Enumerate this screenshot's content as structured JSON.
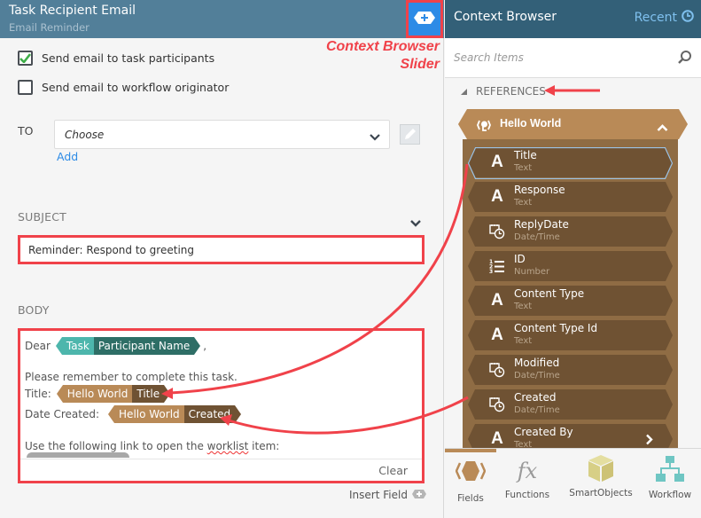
{
  "left_panel": {
    "title": "Task Recipient Email",
    "subtitle": "Email Reminder",
    "slider_button_icon": "context-browser-toggle-icon",
    "annotation_slider": [
      "Context Browser",
      "Slider"
    ],
    "options": [
      {
        "label": "Send email to task participants",
        "checked": true
      },
      {
        "label": "Send email to workflow originator",
        "checked": false
      }
    ],
    "to": {
      "label": "TO",
      "select_value": "Choose",
      "add_link": "Add"
    },
    "subject": {
      "label": "SUBJECT",
      "value": "Reminder: Respond to greeting"
    },
    "body": {
      "label": "BODY",
      "greeting_prefix": "Dear",
      "greeting_chip": {
        "source": "Task",
        "field": "Participant Name"
      },
      "greeting_suffix": ",",
      "line_remember": "Please remember to complete this task.",
      "title_label": "Title:",
      "title_chip": {
        "source": "Hello World",
        "field": "Title"
      },
      "created_label": "Date Created:",
      "created_chip": {
        "source": "Hello World",
        "field": "Created"
      },
      "link_line_pre": "Use the following link to open the ",
      "link_line_misspelled": "worklist",
      "link_line_post": " item:",
      "clear_button": "Clear"
    },
    "insert_field": "Insert Field"
  },
  "context_browser": {
    "title": "Context Browser",
    "recent_label": "Recent",
    "search_placeholder": "Search Items",
    "references_label": "REFERENCES",
    "reference": {
      "name": "Hello World",
      "fields": [
        {
          "name": "Title",
          "type": "Text",
          "icon": "text-icon",
          "selected": true
        },
        {
          "name": "Response",
          "type": "Text",
          "icon": "text-icon"
        },
        {
          "name": "ReplyDate",
          "type": "Date/Time",
          "icon": "datetime-icon"
        },
        {
          "name": "ID",
          "type": "Number",
          "icon": "number-list-icon"
        },
        {
          "name": "Content Type",
          "type": "Text",
          "icon": "text-icon"
        },
        {
          "name": "Content Type Id",
          "type": "Text",
          "icon": "text-icon"
        },
        {
          "name": "Modified",
          "type": "Date/Time",
          "icon": "datetime-icon"
        },
        {
          "name": "Created",
          "type": "Date/Time",
          "icon": "datetime-icon"
        },
        {
          "name": "Created By",
          "type": "Text",
          "icon": "text-icon"
        }
      ]
    },
    "tabs": [
      {
        "label": "Fields",
        "active": true
      },
      {
        "label": "Functions"
      },
      {
        "label": "SmartObjects"
      },
      {
        "label": "Workflow"
      }
    ]
  },
  "colors": {
    "left_header": "#527f99",
    "right_header": "#336078",
    "slider_button": "#2d8be6",
    "annotation_red": "#f0424a",
    "task_chip_light": "#4db6ac",
    "task_chip_dark": "#2e6e66",
    "ref_chip_light": "#b98a57",
    "ref_chip_dark": "#6f5233"
  }
}
